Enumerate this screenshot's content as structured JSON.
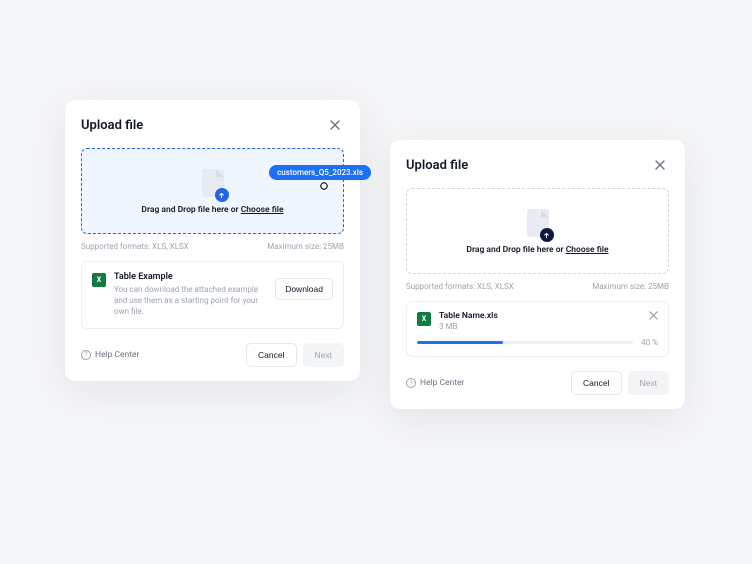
{
  "cardA": {
    "title": "Upload file",
    "dropzone": {
      "text_prefix": "Drag and Drop file here or ",
      "choose_label": "Choose file",
      "dragging_filename": "customers_Q5_2023.xls"
    },
    "supported_formats": "Supported formats:  XLS, XLSX",
    "max_size": "Maximum size: 25MB",
    "example": {
      "title": "Table Example",
      "description": "You can download the attached example and use them as a starting point for your own file.",
      "download_label": "Download"
    },
    "footer": {
      "help": "Help Center",
      "cancel": "Cancel",
      "next": "Next"
    }
  },
  "cardB": {
    "title": "Upload file",
    "dropzone": {
      "text_prefix": "Drag and Drop file here or ",
      "choose_label": "Choose file"
    },
    "supported_formats": "Supported formats:  XLS, XLSX",
    "max_size": "Maximum size: 25MB",
    "upload": {
      "name": "Table Name.xls",
      "size": "3 MB",
      "percent_label": "40 %",
      "percent_value": 40
    },
    "footer": {
      "help": "Help Center",
      "cancel": "Cancel",
      "next": "Next"
    }
  }
}
